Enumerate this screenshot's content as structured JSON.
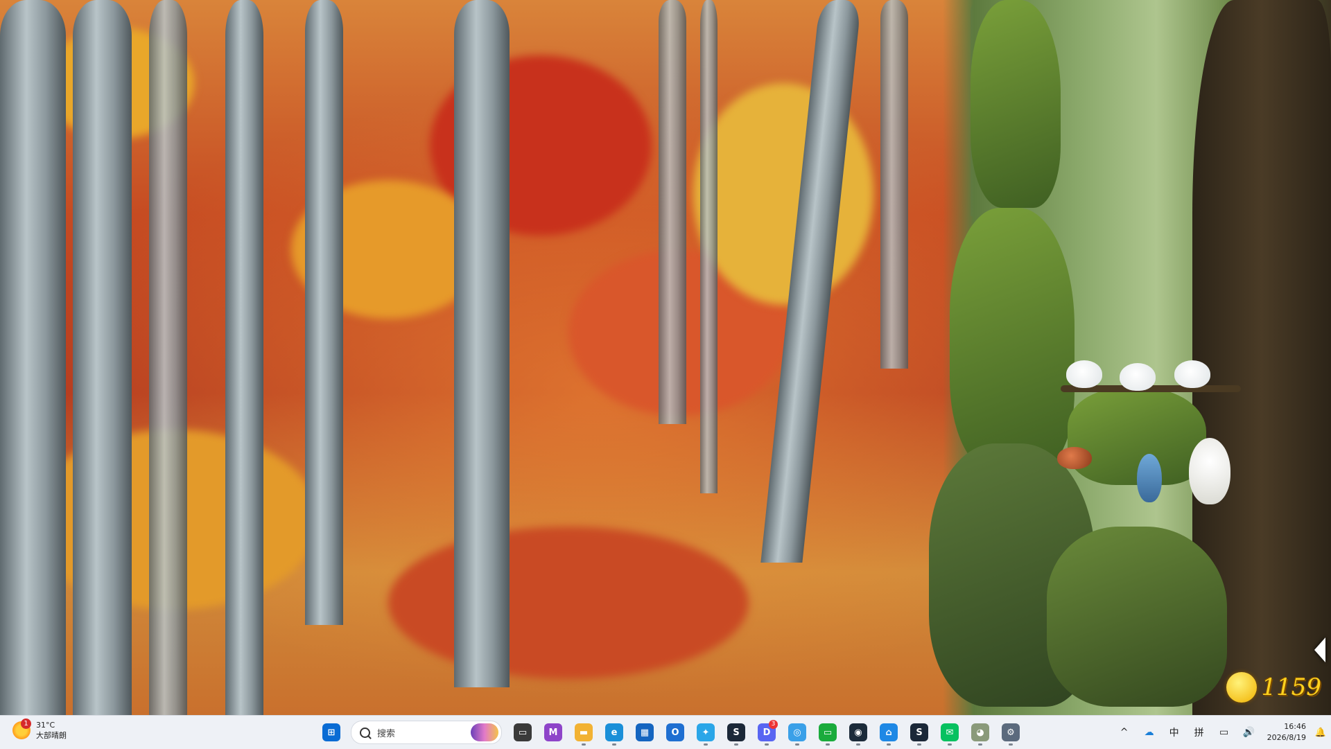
{
  "desktop": {
    "wallpaper_description_colors": {
      "forest": "#c64b22",
      "leaves": "#e8a12a"
    }
  },
  "game_widget": {
    "coin_count": "1159",
    "accent": "#ffd21f"
  },
  "taskbar": {
    "weather": {
      "badge": "1",
      "temperature": "31°C",
      "condition": "大部晴朗"
    },
    "search": {
      "label": "搜索"
    },
    "apps": [
      {
        "name": "start-button",
        "glyph": "⊞",
        "color": "#0a6cd4",
        "running": false,
        "badge": ""
      },
      {
        "name": "task-view-icon",
        "glyph": "▭",
        "color": "#3a3a3a",
        "running": false,
        "badge": ""
      },
      {
        "name": "microsoft-365-icon",
        "glyph": "M",
        "color": "#8e44c9",
        "running": false,
        "badge": ""
      },
      {
        "name": "file-explorer-icon",
        "glyph": "▬",
        "color": "#f2b233",
        "running": true,
        "badge": ""
      },
      {
        "name": "edge-icon",
        "glyph": "e",
        "color": "#1a8fd8",
        "running": true,
        "badge": ""
      },
      {
        "name": "microsoft-store-icon",
        "glyph": "▦",
        "color": "#1565c0",
        "running": false,
        "badge": ""
      },
      {
        "name": "outlook-icon",
        "glyph": "O",
        "color": "#1f6fd1",
        "running": false,
        "badge": ""
      },
      {
        "name": "copilot-icon",
        "glyph": "✦",
        "color": "#2aa6e8",
        "running": true,
        "badge": ""
      },
      {
        "name": "steam-icon",
        "glyph": "S",
        "color": "#1b2838",
        "running": true,
        "badge": ""
      },
      {
        "name": "discord-icon",
        "glyph": "D",
        "color": "#5865f2",
        "running": true,
        "badge": "3"
      },
      {
        "name": "search-app-icon",
        "glyph": "◎",
        "color": "#3aa0e8",
        "running": true,
        "badge": ""
      },
      {
        "name": "chat-app-icon",
        "glyph": "▭",
        "color": "#1aab3c",
        "running": true,
        "badge": ""
      },
      {
        "name": "ring-app-icon",
        "glyph": "◉",
        "color": "#1c2b3a",
        "running": true,
        "badge": ""
      },
      {
        "name": "app-blue-icon",
        "glyph": "⌂",
        "color": "#1e88e5",
        "running": true,
        "badge": ""
      },
      {
        "name": "steam-icon-2",
        "glyph": "S",
        "color": "#1b2838",
        "running": true,
        "badge": ""
      },
      {
        "name": "wechat-icon",
        "glyph": "✉",
        "color": "#07c160",
        "running": true,
        "badge": ""
      },
      {
        "name": "pet-app-icon",
        "glyph": "◕",
        "color": "#8a9a7a",
        "running": true,
        "badge": ""
      },
      {
        "name": "settings-icon",
        "glyph": "⚙",
        "color": "#5b6a7d",
        "running": true,
        "badge": ""
      }
    ],
    "tray": {
      "chevron": "^",
      "onedrive": "☁",
      "ime_mode": "中",
      "ime_input": "拼",
      "network": "▭",
      "volume": "🔊",
      "time": "16:46",
      "date": "2026/8/19",
      "notification": "🔔"
    }
  }
}
